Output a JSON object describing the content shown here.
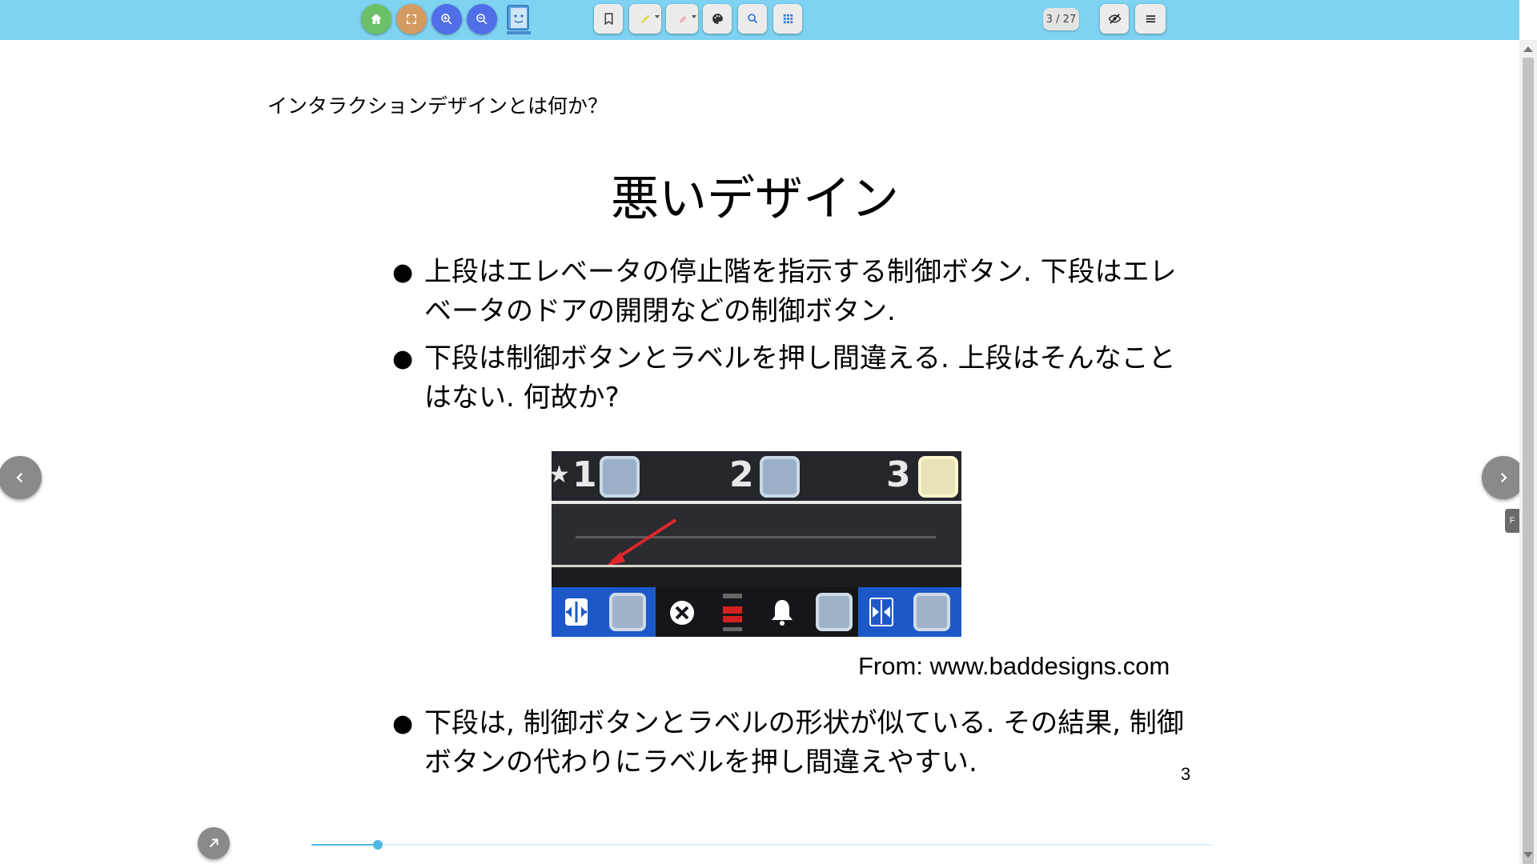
{
  "toolbar": {
    "buttons": [
      {
        "name": "home",
        "icon": "home-icon",
        "color": "#6cc067"
      },
      {
        "name": "fullscreen",
        "icon": "fullscreen-icon",
        "color": "#d39b62"
      },
      {
        "name": "zoom-in",
        "icon": "zoom-in-icon",
        "color": "#4f6ee8"
      },
      {
        "name": "zoom-out",
        "icon": "zoom-out-icon",
        "color": "#4f6ee8"
      }
    ],
    "logo_icon": "book-logo-icon",
    "tools": [
      "bookmark-icon",
      "highlighter-icon",
      "pen-icon",
      "palette-icon",
      "search-icon",
      "grid-icon"
    ],
    "page_counter": "3 / 27",
    "right_icons": [
      "hide-icon",
      "menu-icon"
    ]
  },
  "slide": {
    "header": "インタラクションデザインとは何か？",
    "title": "悪いデザイン",
    "bullets": [
      "上段はエレベータの停止階を指示する制御ボタン. 下段はエレベータのドアの開閉などの制御ボタン.",
      "下段は制御ボタンとラベルを押し間違える. 上段はそんなことはない. 何故か?",
      "下段は, 制御ボタンとラベルの形状が似ている. その結果, 制御ボタンの代わりにラベルを押し間違えやすい."
    ],
    "bullet_glyph": "●",
    "image": {
      "floor_numbers": [
        "1",
        "2",
        "3"
      ],
      "lower_labels": [
        "DOOR",
        "STOP",
        "DOOR"
      ]
    },
    "caption": "From: www.baddesigns.com",
    "page_number": "3"
  },
  "nav": {
    "prev_icon": "chevron-left-icon",
    "next_icon": "chevron-right-icon",
    "side_tab": "F"
  },
  "footer": {
    "share_icon": "external-link-icon",
    "progress_fraction": 0.0741
  },
  "colors": {
    "toolbar_bg": "#7fd3f2",
    "accent": "#4fb8e6"
  }
}
